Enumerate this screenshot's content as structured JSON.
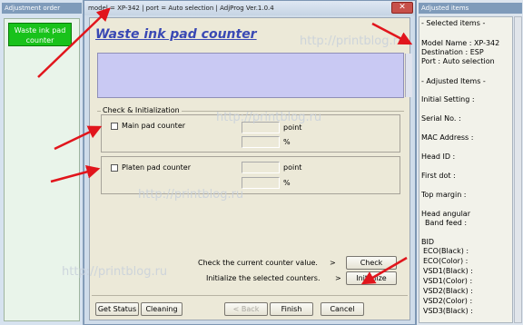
{
  "left_window": {
    "title": "Adjustment order",
    "button_label": "Waste ink pad counter"
  },
  "main_window": {
    "title": "model = XP-342 | port = Auto selection | AdjProg Ver.1.0.4",
    "close_label": "✕",
    "heading": "Waste ink pad counter",
    "group_label": "Check & Initialization",
    "main_pad": {
      "label": "Main pad counter",
      "unit_point": "point",
      "unit_percent": "%"
    },
    "platen_pad": {
      "label": "Platen pad counter",
      "unit_point": "point",
      "unit_percent": "%"
    },
    "check_text": "Check the current counter value.",
    "check_arrow": ">",
    "init_text": "Initialize the selected counters.",
    "init_arrow": ">",
    "check_button": "Check",
    "initialize_button": "Initialize",
    "get_status_button": "Get Status",
    "cleaning_button": "Cleaning",
    "back_button": "< Back",
    "finish_button": "Finish",
    "cancel_button": "Cancel"
  },
  "right_window": {
    "title": "Adjusted items",
    "lines": [
      "- Selected items -",
      "Model Name : XP-342",
      "Destination : ESP",
      "Port : Auto selection",
      "- Adjusted Items -",
      "Initial Setting :",
      "Serial No. :",
      "MAC Address :",
      "Head ID :",
      "First dot :",
      "Top margin :",
      "Head angular",
      "Band feed :",
      "BID",
      "ECO(Black) :",
      "ECO(Color) :",
      "VSD1(Black) :",
      "VSD1(Color) :",
      "VSD2(Black) :",
      "VSD2(Color) :",
      "VSD3(Black) :"
    ]
  },
  "watermark": "http://printblog.ru",
  "colors": {
    "heading": "#3a49b4",
    "green_button": "#19c21b",
    "arrow": "#e1151c",
    "message_area": "#c9c9f3"
  }
}
